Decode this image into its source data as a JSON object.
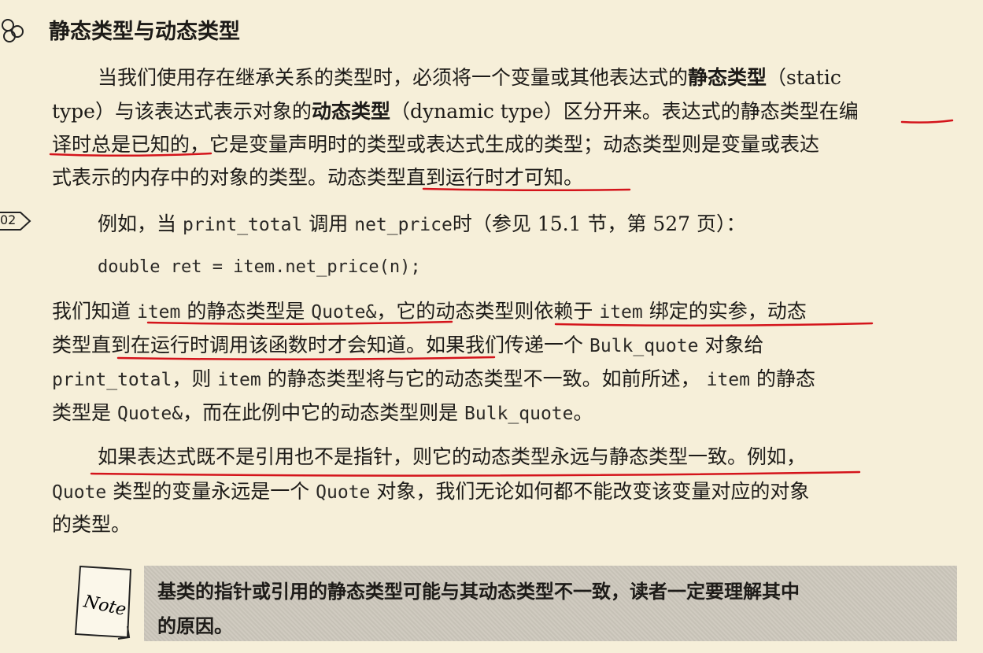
{
  "heading": "静态类型与动态类型",
  "marker_number": "02",
  "para1": {
    "l1_a": "当我们使用存在继承关系的类型时，必须将一个变量或其他表达式的",
    "l1_b": "静态类型",
    "l1_c": "（static",
    "l2_a": "type）与该表达式表示对象的",
    "l2_b": "动态类型",
    "l2_c": "（dynamic type）区分开来。表达式的静态类型在编",
    "l3": "译时总是已知的，它是变量声明时的类型或表达式生成的类型；动态类型则是变量或表达",
    "l4": "式表示的内存中的对象的类型。动态类型直到运行时才可知。"
  },
  "example": {
    "l1_a": "例如，当",
    "l1_b": "print_total",
    "l1_c": "调用",
    "l1_d": "net_price",
    "l1_e": "时（参见 15.1 节，第 527 页）：",
    "code": "double ret = item.net_price(n);"
  },
  "para2": {
    "l1_a": "我们知道",
    "l1_b": "item",
    "l1_c": "的静态类型是",
    "l1_d": "Quote&",
    "l1_e": "，它的动态类型则依赖于",
    "l1_f": "item",
    "l1_g": "绑定的实参，动态",
    "l2_a": "类型直到在运行时调用该函数时才会知道。如果我们传递一个",
    "l2_b": "Bulk_quote",
    "l2_c": "对象给",
    "l3_a": "print_total",
    "l3_b": "，则",
    "l3_c": "item",
    "l3_d": "的静态类型将与它的动态类型不一致。如前所述，",
    "l3_e": "item",
    "l3_f": "的静态",
    "l4_a": "类型是",
    "l4_b": "Quote&",
    "l4_c": "，而在此例中它的动态类型则是",
    "l4_d": "Bulk_quote",
    "l4_e": "。"
  },
  "para3": {
    "l1": "如果表达式既不是引用也不是指针，则它的动态类型永远与静态类型一致。例如，",
    "l2_a": "Quote",
    "l2_b": "类型的变量永远是一个",
    "l2_c": "Quote",
    "l2_d": "对象，我们无论如何都不能改变该变量对应的对象",
    "l3": "的类型。"
  },
  "note": {
    "icon_text": "Note",
    "l1": "基类的指针或引用的静态类型可能与其动态类型不一致，读者一定要理解其中",
    "l2": "的原因。"
  },
  "colors": {
    "underline": "#d4141b",
    "background": "#f6efd9",
    "note_bg": "#cbc6bb"
  }
}
